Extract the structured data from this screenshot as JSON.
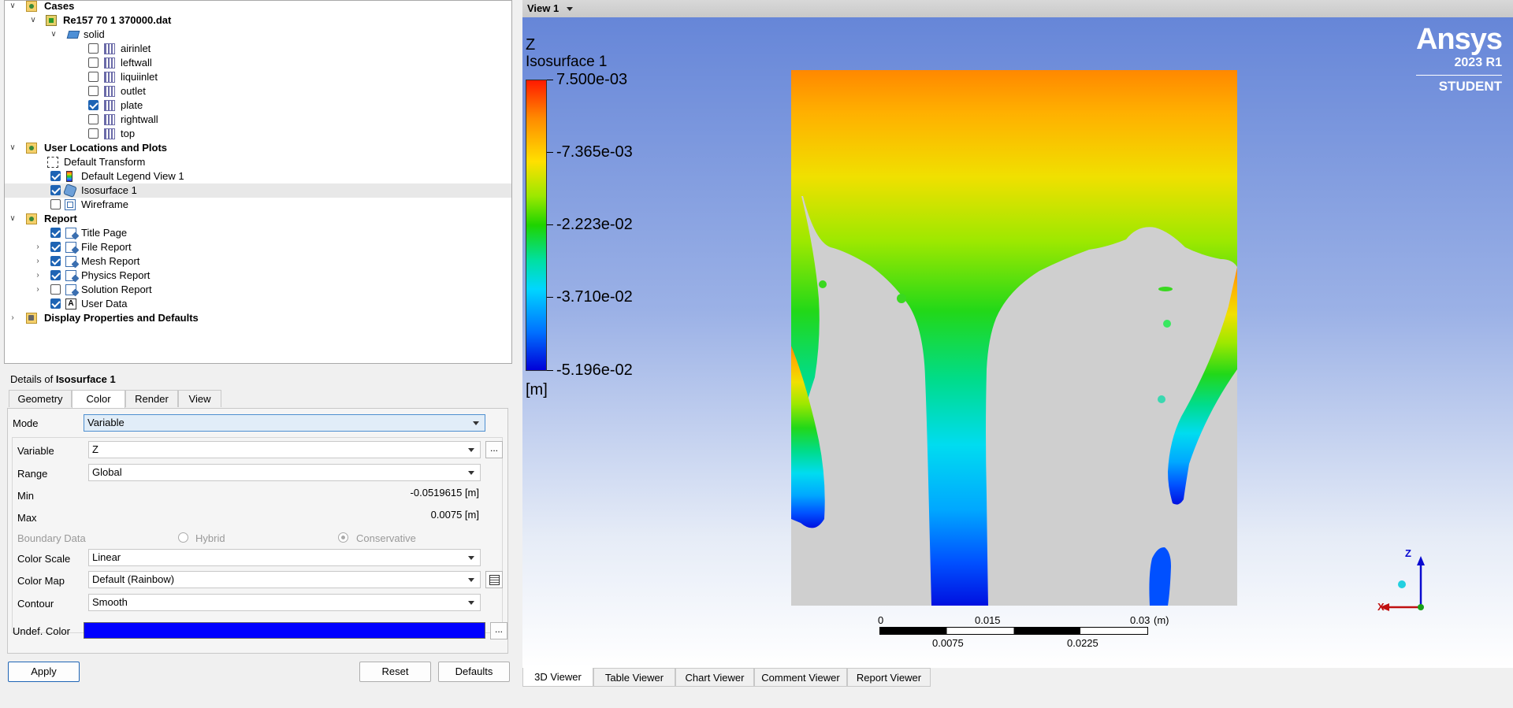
{
  "tree": {
    "cases": "Cases",
    "file": "Re157 70 1 370000.dat",
    "solid": "solid",
    "boundaries": [
      {
        "label": "airinlet",
        "checked": false
      },
      {
        "label": "leftwall",
        "checked": false
      },
      {
        "label": "liquiinlet",
        "checked": false
      },
      {
        "label": "outlet",
        "checked": false
      },
      {
        "label": "plate",
        "checked": true
      },
      {
        "label": "rightwall",
        "checked": false
      },
      {
        "label": "top",
        "checked": false
      }
    ],
    "user_locations": "User Locations and Plots",
    "default_transform": "Default Transform",
    "default_legend": "Default Legend View 1",
    "isosurface": "Isosurface 1",
    "wireframe": "Wireframe",
    "report": "Report",
    "report_items": [
      {
        "label": "Title Page",
        "checked": true
      },
      {
        "label": "File Report",
        "checked": true
      },
      {
        "label": "Mesh Report",
        "checked": true
      },
      {
        "label": "Physics Report",
        "checked": true
      },
      {
        "label": "Solution Report",
        "checked": false
      },
      {
        "label": "User Data",
        "checked": true
      }
    ],
    "display_props": "Display Properties and Defaults"
  },
  "details": {
    "prefix": "Details of ",
    "object": "Isosurface 1",
    "tabs": [
      "Geometry",
      "Color",
      "Render",
      "View"
    ],
    "mode_label": "Mode",
    "mode_value": "Variable",
    "variable_label": "Variable",
    "variable_value": "Z",
    "range_label": "Range",
    "range_value": "Global",
    "min_label": "Min",
    "min_value": "-0.0519615 [m]",
    "max_label": "Max",
    "max_value": "0.0075 [m]",
    "boundary_label": "Boundary Data",
    "hybrid": "Hybrid",
    "conservative": "Conservative",
    "color_scale_label": "Color Scale",
    "color_scale_value": "Linear",
    "color_map_label": "Color Map",
    "color_map_value": "Default (Rainbow)",
    "contour_label": "Contour",
    "contour_value": "Smooth",
    "undef_label": "Undef. Color",
    "undef_color": "#0000ff",
    "ellipsis": "...",
    "apply": "Apply",
    "reset": "Reset",
    "defaults": "Defaults"
  },
  "viewer": {
    "title": "View 1",
    "legend_var": "Z",
    "legend_name": "Isosurface 1",
    "legend_values": [
      "7.500e-03",
      "-7.365e-03",
      "-2.223e-02",
      "-3.710e-02",
      "-5.196e-02"
    ],
    "legend_unit": "[m]",
    "logo_name": "Ansys",
    "logo_version": "2023 R1",
    "logo_edition": "STUDENT",
    "scale_top": [
      "0",
      "0.015",
      "0.03",
      "(m)"
    ],
    "scale_bottom": [
      "0.0075",
      "0.0225"
    ],
    "axis_z": "Z",
    "axis_x": "X",
    "bottom_tabs": [
      "3D Viewer",
      "Table Viewer",
      "Chart Viewer",
      "Comment Viewer",
      "Report Viewer"
    ]
  }
}
